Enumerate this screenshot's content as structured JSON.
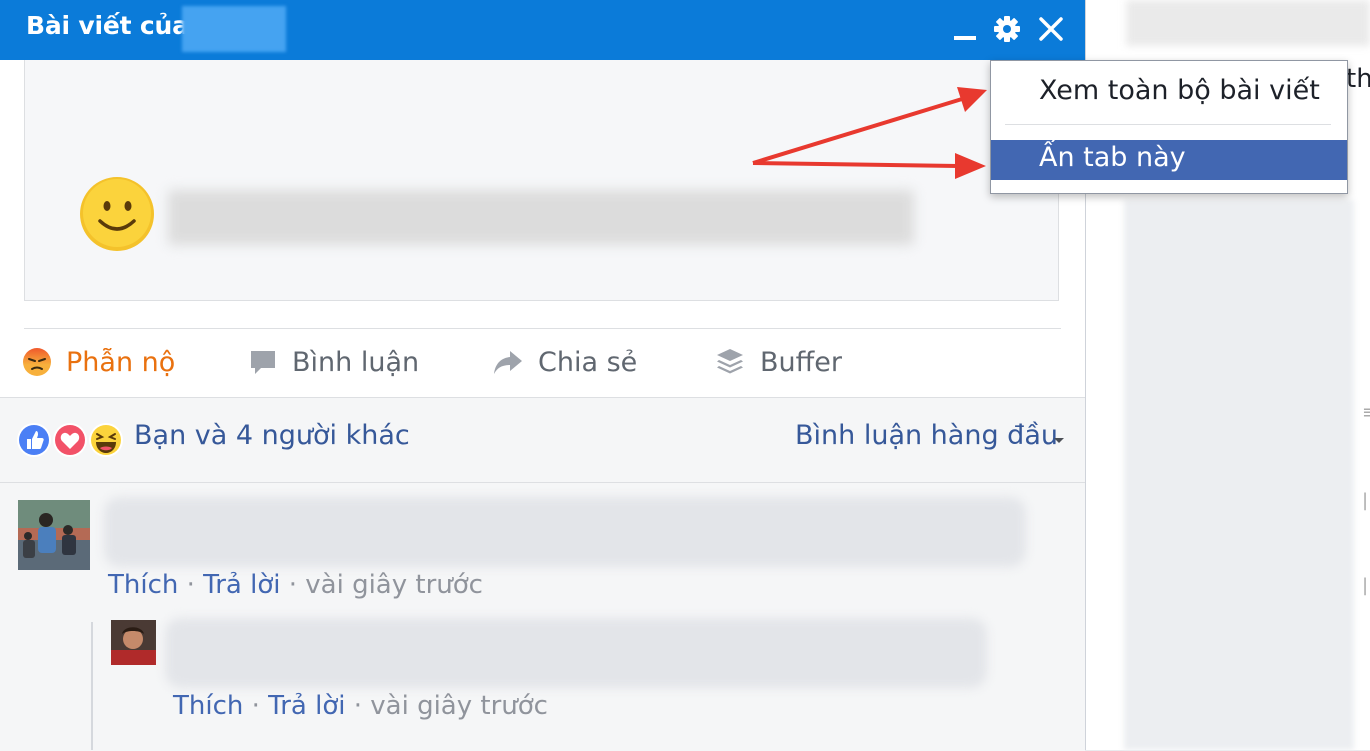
{
  "chat_window": {
    "title": "Bài viết của",
    "controls": [
      "minimize-icon",
      "gear-icon",
      "close-icon"
    ],
    "accent_color": "#0b7bd9"
  },
  "post": {
    "actions": [
      {
        "label": "Phẫn nộ",
        "icon": "angry-reaction-icon",
        "color": "#e9710f"
      },
      {
        "label": "Bình luận",
        "icon": "comment-icon"
      },
      {
        "label": "Chia sẻ",
        "icon": "share-icon"
      },
      {
        "label": "Buffer",
        "icon": "buffer-icon"
      }
    ],
    "reactions_summary": "Bạn và 4 người khác",
    "reaction_icons": [
      "like-icon",
      "love-icon",
      "haha-icon"
    ],
    "sort_label": "Bình luận hàng đầu"
  },
  "comments": [
    {
      "like": "Thích",
      "reply": "Trả lời",
      "time": "vài giây trước"
    },
    {
      "like": "Thích",
      "reply": "Trả lời",
      "time": "vài giây trước"
    }
  ],
  "menu": {
    "items": [
      "Xem toàn bộ bài viết",
      "Ấn tab này"
    ],
    "highlight_color": "#4267b2"
  },
  "right_column": {
    "partial_text": "th"
  }
}
